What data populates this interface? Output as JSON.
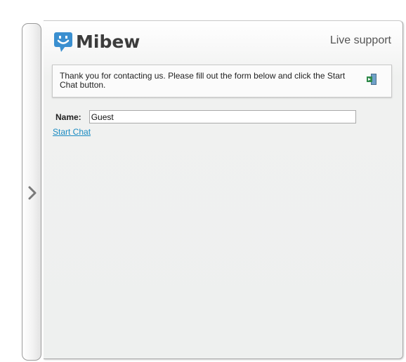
{
  "side_tab": {
    "icon": "chevron-right-icon"
  },
  "header": {
    "logo_icon": "smiley-chat-bubble-icon",
    "logo_text": "Mibew",
    "tagline": "Live support",
    "brand_color": "#3a8fd0"
  },
  "message": {
    "text": "Thank you for contacting us. Please fill out the form below and click the Start Chat button.",
    "exit_icon": "exit-door-icon"
  },
  "form": {
    "name_label": "Name:",
    "name_value": "Guest",
    "start_chat_label": "Start Chat",
    "link_color": "#1a8bc2"
  }
}
